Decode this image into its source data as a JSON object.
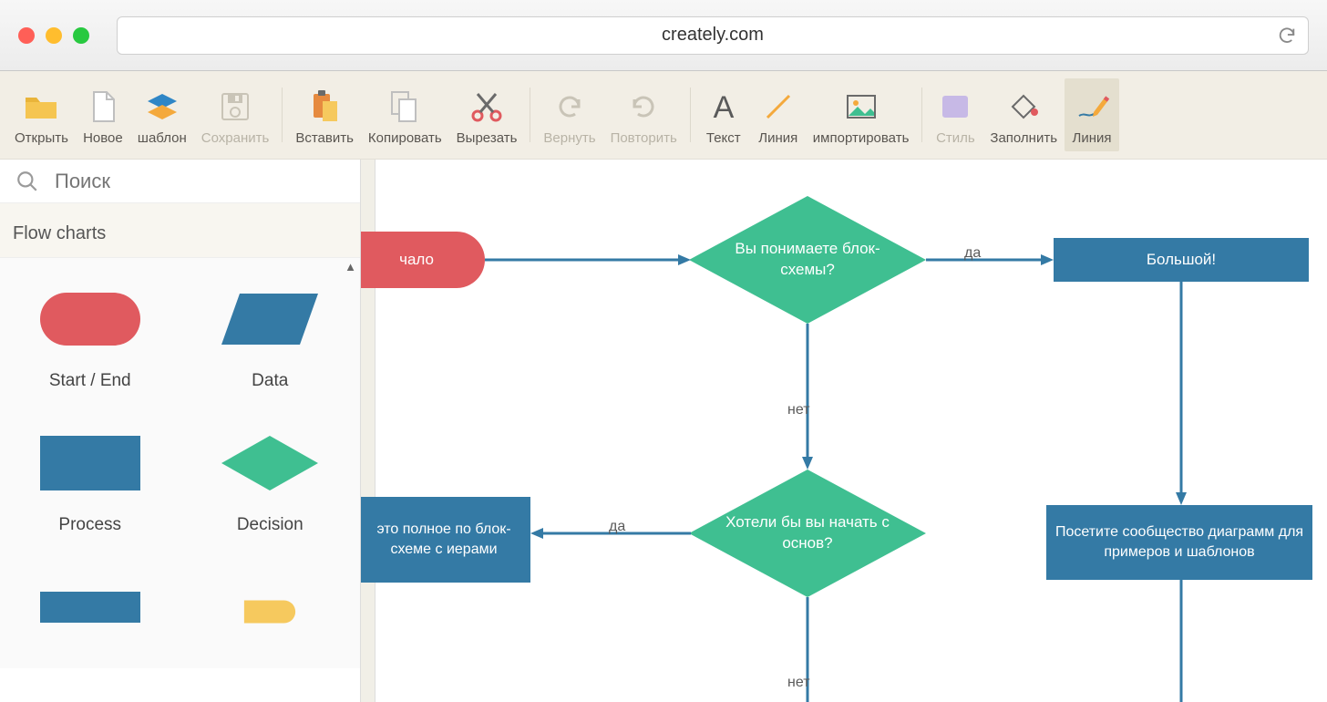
{
  "browser": {
    "url": "creately.com"
  },
  "toolbar": {
    "items": [
      {
        "id": "open",
        "label": "Открыть"
      },
      {
        "id": "new",
        "label": "Новое"
      },
      {
        "id": "template",
        "label": "шаблон"
      },
      {
        "id": "save",
        "label": "Сохранить",
        "disabled": true
      },
      {
        "id": "paste",
        "label": "Вставить"
      },
      {
        "id": "copy",
        "label": "Копировать"
      },
      {
        "id": "cut",
        "label": "Вырезать"
      },
      {
        "id": "undo",
        "label": "Вернуть",
        "disabled": true
      },
      {
        "id": "redo",
        "label": "Повторить",
        "disabled": true
      },
      {
        "id": "text",
        "label": "Текст"
      },
      {
        "id": "line",
        "label": "Линия"
      },
      {
        "id": "import",
        "label": "импортировать"
      },
      {
        "id": "style",
        "label": "Стиль",
        "disabled": true
      },
      {
        "id": "fill",
        "label": "Заполнить"
      },
      {
        "id": "linetool",
        "label": "Линия",
        "active": true
      }
    ],
    "separators_after": [
      3,
      6,
      8,
      11
    ]
  },
  "sidebar": {
    "search_placeholder": "Поиск",
    "category": "Flow charts",
    "shapes": [
      {
        "name": "Start / End",
        "type": "startend"
      },
      {
        "name": "Data",
        "type": "data"
      },
      {
        "name": "Process",
        "type": "process"
      },
      {
        "name": "Decision",
        "type": "decision"
      }
    ]
  },
  "flowchart": {
    "nodes": {
      "start": {
        "text": "чало"
      },
      "d1": {
        "text": "Вы понимаете блок-схемы?"
      },
      "great": {
        "text": "Большой!"
      },
      "d2": {
        "text": "Хотели бы вы начать  с основ?"
      },
      "tutorial": {
        "text": "это полное по блок-схеме с иерами"
      },
      "visit": {
        "text": "Посетите сообщество диаграмм для примеров и шаблонов"
      }
    },
    "edge_labels": {
      "d1_yes": "да",
      "d1_no": "нет",
      "d2_yes": "да",
      "d2_no": "нет"
    }
  },
  "colors": {
    "process": "#347aa5",
    "decision": "#3fbf91",
    "terminator": "#e05a5f"
  }
}
